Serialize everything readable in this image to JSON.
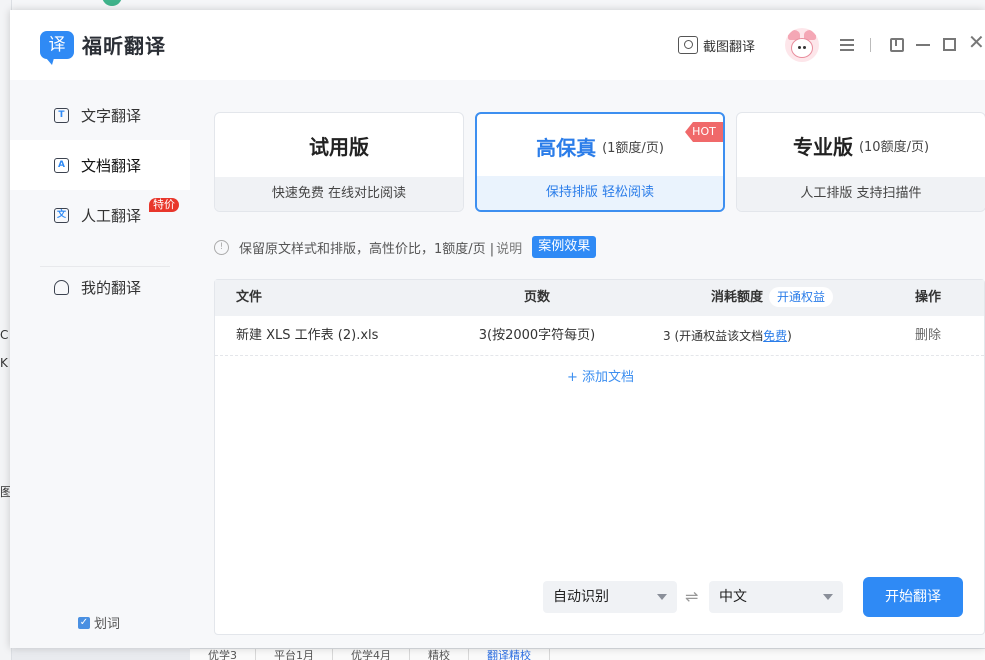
{
  "app": {
    "name": "福昕翻译",
    "logo_char": "译"
  },
  "header": {
    "screenshot_translate": "截图翻译"
  },
  "sidebar": {
    "items": [
      {
        "label": "文字翻译",
        "icon": "text-translate-icon"
      },
      {
        "label": "文档翻译",
        "icon": "doc-translate-icon"
      },
      {
        "label": "人工翻译",
        "icon": "human-translate-icon",
        "badge": "特价"
      },
      {
        "label": "我的翻译",
        "icon": "my-translation-icon"
      }
    ],
    "word_pick": "划词"
  },
  "plans": [
    {
      "name": "试用版",
      "price": "",
      "desc": "快速免费 在线对比阅读"
    },
    {
      "name": "高保真",
      "price": "(1额度/页)",
      "desc": "保持排版 轻松阅读",
      "tag": "HOT"
    },
    {
      "name": "专业版",
      "price": "(10额度/页)",
      "desc": "人工排版 支持扫描件"
    }
  ],
  "notice": {
    "text": "保留原文样式和排版，高性价比，1额度/页 |",
    "explain": "说明",
    "case_button": "案例效果"
  },
  "table": {
    "headers": {
      "file": "文件",
      "pages": "页数",
      "quota": "消耗额度",
      "quota_pill": "开通权益",
      "action": "操作"
    },
    "rows": [
      {
        "file": "新建 XLS 工作表 (2).xls",
        "pages": "3(按2000字符每页)",
        "quota": "3 (开通权益该文档",
        "free": "免费",
        "quota_end": ")",
        "action": "删除"
      }
    ],
    "add_doc": "+ 添加文档"
  },
  "controls": {
    "source_lang": "自动识别",
    "target_lang": "中文",
    "start_button": "开始翻译"
  },
  "background": {
    "bottom_tabs": [
      "优学3",
      "平台1月",
      "优学4月",
      "精校",
      "翻译精校"
    ],
    "left_fragments": [
      "C",
      "K ",
      "图"
    ]
  },
  "colors": {
    "accent": "#2f8af5",
    "hot": "#f0696a",
    "badge": "#e8362b"
  }
}
